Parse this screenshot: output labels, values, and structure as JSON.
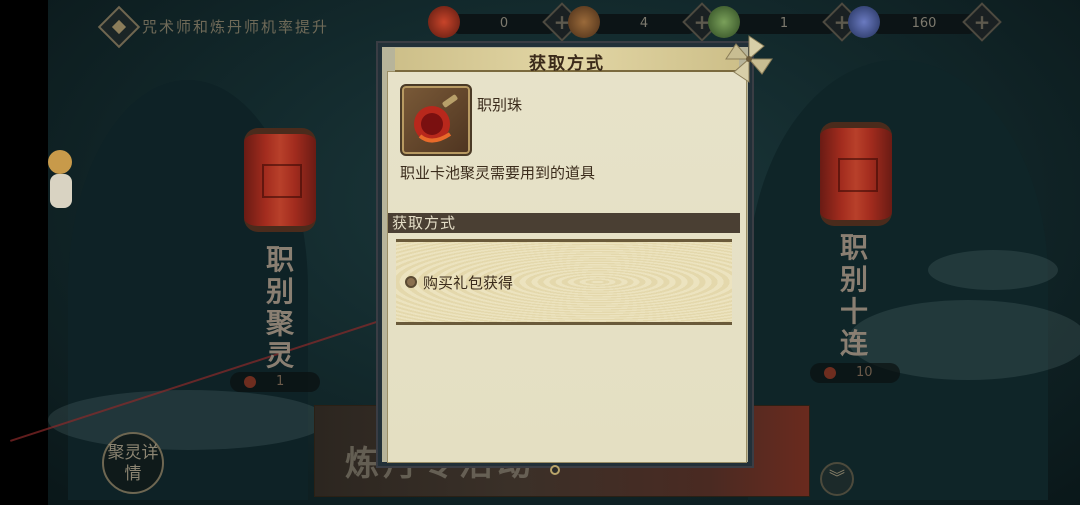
{
  "top_bar": {
    "quest_text": "咒术师和炼丹师机率提升",
    "resources": [
      {
        "icon": "red-orb-icon",
        "value": "0"
      },
      {
        "icon": "chest-icon",
        "value": "4"
      },
      {
        "icon": "green-scroll-icon",
        "value": "1"
      },
      {
        "icon": "crystal-icon",
        "value": "160"
      }
    ],
    "plus_label": "+"
  },
  "scene": {
    "left_lantern_label": "职别聚灵",
    "left_lantern_cost": "1",
    "right_lantern_label": "职别十连",
    "right_lantern_cost": "10",
    "details_button": "聚灵详情",
    "banner_text": "炼丹专活动",
    "more_icon": "double-chevron-down-icon",
    "more_label": "︾"
  },
  "dialog": {
    "title": "获取方式",
    "item_name": "职别珠",
    "item_description": "职业卡池聚灵需要用到的道具",
    "section_title": "获取方式",
    "sources": [
      "购买礼包获得"
    ]
  },
  "colors": {
    "panel": "#e7e2c9",
    "section_bar": "#4a3f33",
    "lantern_red": "#a32c1e",
    "scene_bg": "#132a2d"
  }
}
